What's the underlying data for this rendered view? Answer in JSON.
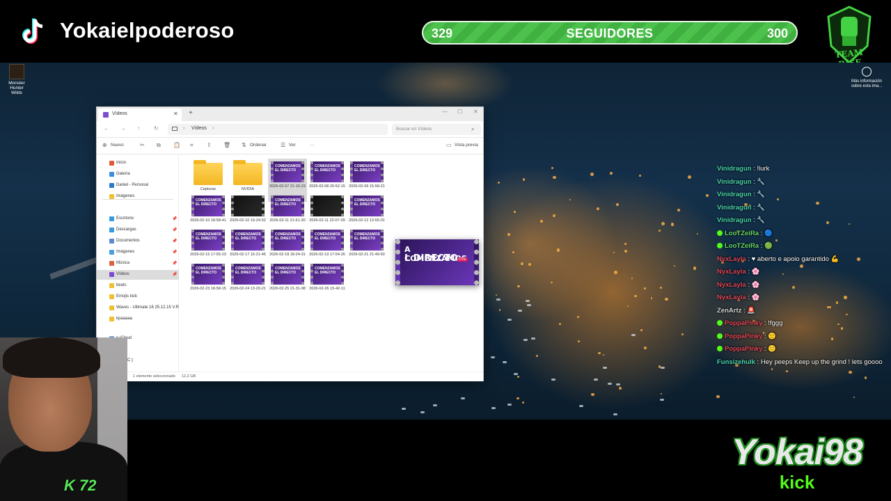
{
  "overlay": {
    "channel_name": "Yokaielpoderoso",
    "followers": {
      "current": "329",
      "label": "SEGUIDORES",
      "goal": "300"
    },
    "team_badge_text": "TEAM RISE ABOVE",
    "brand_name": "Yokai98",
    "brand_platform": "kick",
    "cam_badge": "K 72"
  },
  "desktop": {
    "icons": [
      {
        "label": "Monster Hunter Wilds",
        "icon": "game-icon"
      }
    ],
    "info_label": "Más información sobre esta ima..."
  },
  "explorer": {
    "tab_title": "Vídeos",
    "address": "Vídeos",
    "search_placeholder": "Buscar en Vídeos",
    "toolbar": {
      "new": "Nuevo",
      "sort": "Ordenar",
      "view": "Ver",
      "more": "···",
      "preview": "Vista previa"
    },
    "sidebar": [
      {
        "label": "Inicio",
        "icon": "home-icon",
        "color": "#e05a3a"
      },
      {
        "label": "Galería",
        "icon": "gallery-icon",
        "color": "#3a8fe0"
      },
      {
        "label": "Daniel - Personal",
        "icon": "cloud-icon",
        "color": "#2a7ad0"
      },
      {
        "label": "Imágenes",
        "icon": "folder-icon",
        "color": "#f0c030"
      },
      {
        "label": "Escritorio",
        "icon": "desktop-icon",
        "color": "#3a9ae0"
      },
      {
        "label": "Descargas",
        "icon": "download-icon",
        "color": "#3a9ae0"
      },
      {
        "label": "Documentos",
        "icon": "documents-icon",
        "color": "#5a8ad0"
      },
      {
        "label": "Imágenes",
        "icon": "pictures-icon",
        "color": "#4aa0e0"
      },
      {
        "label": "Música",
        "icon": "music-icon",
        "color": "#e06040"
      },
      {
        "label": "Vídeos",
        "icon": "videos-icon",
        "color": "#7a4cd0"
      },
      {
        "label": "beats",
        "icon": "folder-icon",
        "color": "#f0c030"
      },
      {
        "label": "Emojis kick",
        "icon": "folder-icon",
        "color": "#f0c030"
      },
      {
        "label": "Waves - Ultimate 16 25.12.15 V.R",
        "icon": "folder-icon",
        "color": "#f0c030"
      },
      {
        "label": "kpaaaaa",
        "icon": "folder-icon",
        "color": "#f0c030"
      },
      {
        "label": "n iCloud",
        "icon": "cloud-icon",
        "color": "#7aa0d0"
      },
      {
        "label": "quipo",
        "icon": "pc-icon",
        "color": "#4a7ad0"
      },
      {
        "label": "local (C:)",
        "icon": "drive-icon",
        "color": "#888888"
      }
    ],
    "items": [
      {
        "type": "folder",
        "name": "Capturas"
      },
      {
        "type": "folder",
        "name": "NVIDIA"
      },
      {
        "type": "video",
        "name": "2026-02-07 21-15-23",
        "selected": true
      },
      {
        "type": "video",
        "name": "2026-02-08 20-52-15"
      },
      {
        "type": "video",
        "name": "2026-02-09 15-58-21"
      },
      {
        "type": "video",
        "name": "2026-02-10 18-58-41"
      },
      {
        "type": "video-dark",
        "name": "2026-02-10 19-24-52"
      },
      {
        "type": "video",
        "name": "2026-02-11 21-51-30"
      },
      {
        "type": "video-dark",
        "name": "2026-02-11 22-07-39"
      },
      {
        "type": "video",
        "name": "2026-02-12 13-55-01"
      },
      {
        "type": "video",
        "name": "2026-02-15 17-55-23"
      },
      {
        "type": "video",
        "name": "2026-02-17 15-21-45"
      },
      {
        "type": "video",
        "name": "2026-02-18 18-24-31"
      },
      {
        "type": "video",
        "name": "2026-02-19 17-54-26"
      },
      {
        "type": "video",
        "name": "2026-02-21 21-49-50"
      },
      {
        "type": "video",
        "name": "2026-02-23 18-58-15"
      },
      {
        "type": "video",
        "name": "2026-02-24 13-20-21"
      },
      {
        "type": "video",
        "name": "2026-02-25 21-31-08"
      },
      {
        "type": "video",
        "name": "2026-02-26 15-42-11"
      }
    ],
    "thumb_text": "COMENZAMOS EL DIRECTO",
    "status": {
      "selection": "1 elemento seleccionado",
      "size": "12,2 GB"
    }
  },
  "drag_preview": {
    "line1": "A COMENZAMOS",
    "line2": "L DIRECTO",
    "badge": "LIVE"
  },
  "chat": [
    {
      "user": "Vinidragun",
      "msg": "!lurk",
      "color": "#4ad8b0",
      "badge": false
    },
    {
      "user": "Vinidragun",
      "msg": "🔧",
      "color": "#4ad8b0",
      "badge": false
    },
    {
      "user": "Vinidragun",
      "msg": "🔧",
      "color": "#4ad8b0",
      "badge": false
    },
    {
      "user": "Vinidragun",
      "msg": "🔧",
      "color": "#4ad8b0",
      "badge": false
    },
    {
      "user": "Vinidragun",
      "msg": "🔧",
      "color": "#4ad8b0",
      "badge": false
    },
    {
      "user": "LooTZeiRa",
      "msg": "🔵",
      "color": "#6ad86a",
      "badge": true
    },
    {
      "user": "LooTZeiRa",
      "msg": "🟢",
      "color": "#6ad86a",
      "badge": true
    },
    {
      "user": "NyxLayla",
      "msg": "♥ aberto e apoio garantido 💪",
      "color": "#e04a5a",
      "badge": false
    },
    {
      "user": "NyxLayla",
      "msg": "🌸",
      "color": "#e04a5a",
      "badge": false
    },
    {
      "user": "NyxLayla",
      "msg": "🌸",
      "color": "#e04a5a",
      "badge": false
    },
    {
      "user": "NyxLayla",
      "msg": "🌸",
      "color": "#e04a5a",
      "badge": false
    },
    {
      "user": "ZenArtz",
      "msg": "🚨",
      "color": "#d8d8d8",
      "badge": false
    },
    {
      "user": "PoppaPinky",
      "msg": "!fggg",
      "color": "#e04a5a",
      "badge": true
    },
    {
      "user": "PoppaPinky",
      "msg": "🙂",
      "color": "#e04a5a",
      "badge": true
    },
    {
      "user": "PoppaPinky",
      "msg": "🙂",
      "color": "#e04a5a",
      "badge": true
    },
    {
      "user": "Funsizehulk",
      "msg": "Hey peeps Keep up the grind ! lets goooo",
      "color": "#4ad8b0",
      "badge": false
    }
  ],
  "colors": {
    "accent_green": "#53fc18",
    "follower_bar": "#4cc24c"
  }
}
